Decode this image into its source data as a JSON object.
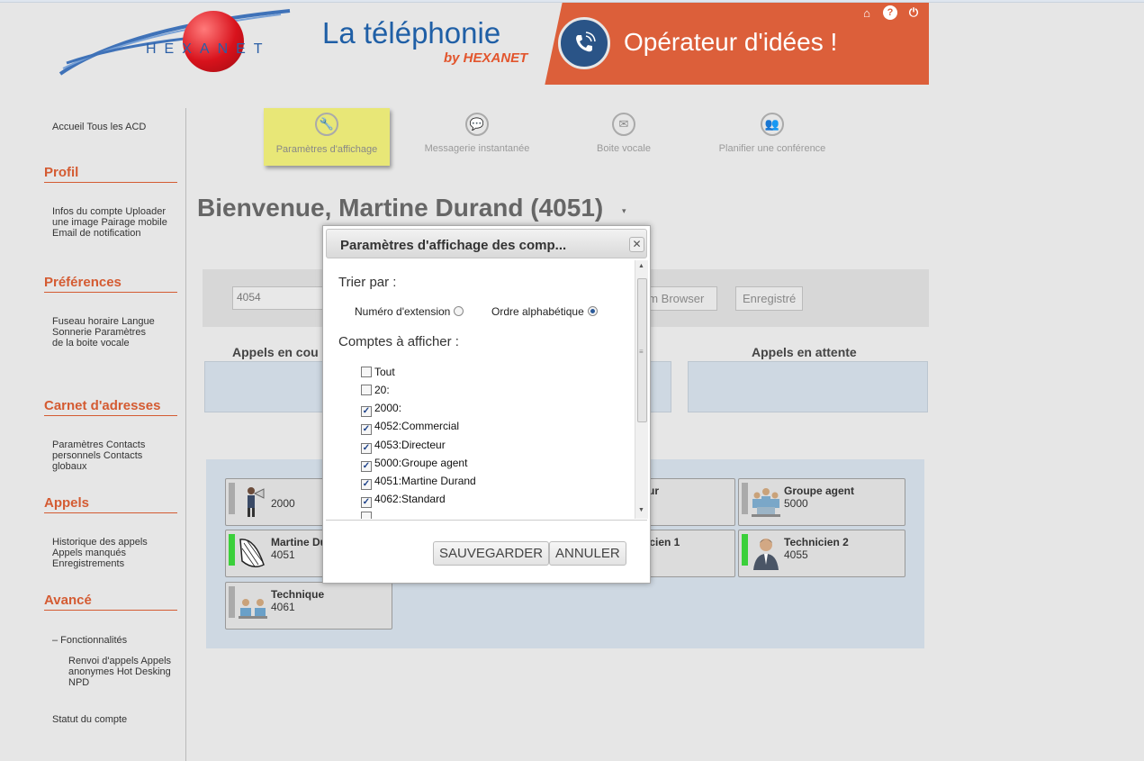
{
  "header": {
    "brand": "HEXANET",
    "product": "La téléphonie",
    "product_by": "by HEXANET",
    "slogan": "Opérateur d'idées !",
    "icons": [
      "home-icon",
      "help-icon",
      "power-icon"
    ]
  },
  "sidebar": {
    "top_links": [
      "Accueil",
      "Tous les ACD"
    ],
    "sections": [
      {
        "title": "Profil",
        "items": [
          "Infos du compte",
          "Uploader une image",
          "Pairage mobile",
          "Email de notification"
        ]
      },
      {
        "title": "Préférences",
        "items": [
          "Fuseau horaire",
          "Langue",
          "Sonnerie",
          "Paramètres de la boite vocale"
        ]
      },
      {
        "title": "Carnet d'adresses",
        "items": [
          "Paramètres",
          "Contacts personnels",
          "Contacts globaux"
        ]
      },
      {
        "title": "Appels",
        "items": [
          "Historique des appels",
          "Appels manqués",
          "Enregistrements"
        ]
      },
      {
        "title": "Avancé",
        "items": [
          "– Fonctionnalités"
        ],
        "sub_items": [
          "Renvoi d'appels",
          "Appels anonymes",
          "Hot Desking",
          "NPD"
        ],
        "after": [
          "Statut du compte"
        ]
      }
    ]
  },
  "tabs": [
    {
      "label": "Paramètres d'affichage",
      "icon": "wrench-icon",
      "active": true
    },
    {
      "label": "Messagerie instantanée",
      "icon": "chat-icon",
      "active": false
    },
    {
      "label": "Boite vocale",
      "icon": "envelope-icon",
      "active": false
    },
    {
      "label": "Planifier une conférence",
      "icon": "group-icon",
      "active": false
    }
  ],
  "welcome": "Bienvenue, Martine Durand (4051)",
  "filter": {
    "extension_value": "4054",
    "btn_browser": "om Browser",
    "btn_registered": "Enregistré"
  },
  "calls": {
    "current_title": "Appels en cou",
    "waiting_title": "Appels en attente"
  },
  "contacts": [
    {
      "name": "",
      "number": "2000",
      "status": "grey",
      "avatar": "megaphone-avatar"
    },
    {
      "name": "Martine Du",
      "number": "4051",
      "status": "green",
      "avatar": "fan-avatar"
    },
    {
      "name": "Technique",
      "number": "4061",
      "status": "grey",
      "avatar": "team-avatar"
    },
    {
      "name": "ur",
      "number": "",
      "status": "none",
      "avatar": ""
    },
    {
      "name": "icien 1",
      "number": "",
      "status": "none",
      "avatar": ""
    },
    {
      "name": "Groupe agent",
      "number": "5000",
      "status": "grey",
      "avatar": "agents-avatar"
    },
    {
      "name": "Technicien 2",
      "number": "4055",
      "status": "green",
      "avatar": "person-avatar"
    }
  ],
  "modal": {
    "title": "Paramètres d'affichage des comp...",
    "sort_label": "Trier par :",
    "sort_options": [
      {
        "label": "Numéro d'extension",
        "selected": false
      },
      {
        "label": "Ordre alphabétique",
        "selected": true
      }
    ],
    "accounts_label": "Comptes à afficher :",
    "accounts": [
      {
        "label": "Tout",
        "checked": false
      },
      {
        "label": "20:",
        "checked": false
      },
      {
        "label": "2000:",
        "checked": true
      },
      {
        "label": "4052:Commercial",
        "checked": true
      },
      {
        "label": "4053:Directeur",
        "checked": true
      },
      {
        "label": "5000:Groupe agent",
        "checked": true
      },
      {
        "label": "4051:Martine Durand",
        "checked": true
      },
      {
        "label": "4062:Standard",
        "checked": true
      }
    ],
    "save_label": "SAUVEGARDER",
    "cancel_label": "ANNULER"
  }
}
